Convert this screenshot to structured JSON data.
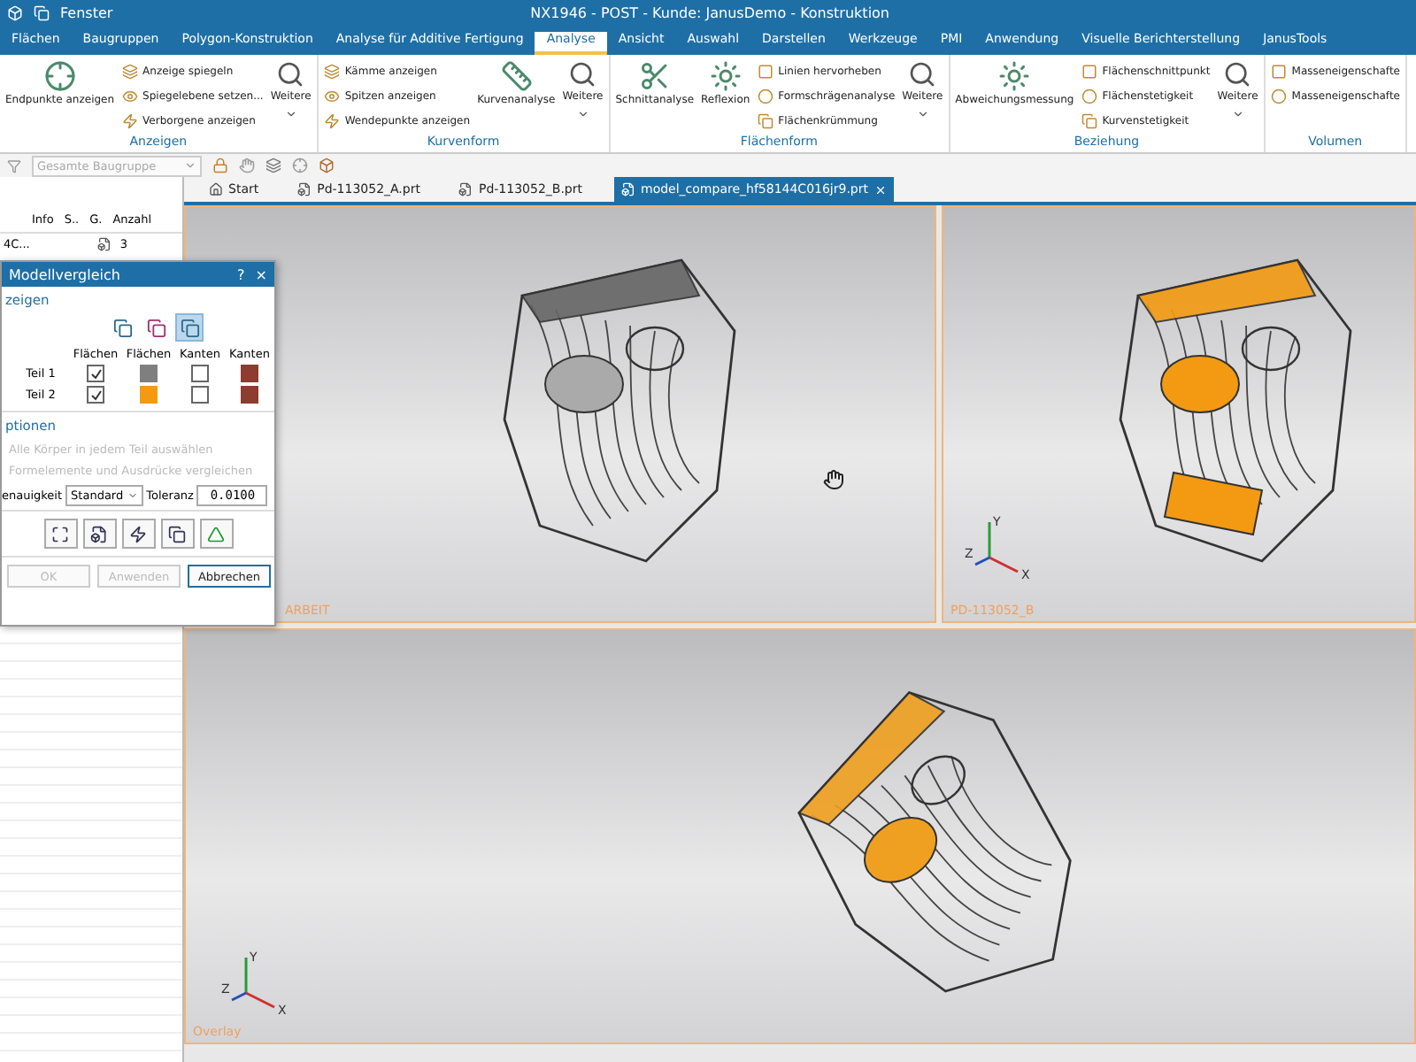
{
  "quick_access": {
    "window_menu": "Fenster"
  },
  "title": "NX1946 - POST - Kunde: JanusDemo - Konstruktion",
  "ribbon_tabs": [
    {
      "label": "Flächen",
      "selected": false
    },
    {
      "label": "Baugruppen",
      "selected": false
    },
    {
      "label": "Polygon-Konstruktion",
      "selected": false
    },
    {
      "label": "Analyse für Additive Fertigung",
      "selected": false
    },
    {
      "label": "Analyse",
      "selected": true
    },
    {
      "label": "Ansicht",
      "selected": false
    },
    {
      "label": "Auswahl",
      "selected": false
    },
    {
      "label": "Darstellen",
      "selected": false
    },
    {
      "label": "Werkzeuge",
      "selected": false
    },
    {
      "label": "PMI",
      "selected": false
    },
    {
      "label": "Anwendung",
      "selected": false
    },
    {
      "label": "Visuelle Berichterstellung",
      "selected": false
    },
    {
      "label": "JanusTools",
      "selected": false
    }
  ],
  "ribbon_groups": [
    {
      "name": "Anzeigen",
      "items": [
        {
          "kind": "large",
          "label": "Endpunkte anzeigen"
        },
        {
          "kind": "small",
          "label": "Anzeige spiegeln"
        },
        {
          "kind": "small",
          "label": "Spiegelebene setzen..."
        },
        {
          "kind": "small",
          "label": "Verborgene anzeigen"
        },
        {
          "kind": "more",
          "label": "Weitere"
        }
      ]
    },
    {
      "name": "Kurvenform",
      "items": [
        {
          "kind": "small",
          "label": "Kämme anzeigen"
        },
        {
          "kind": "small",
          "label": "Spitzen anzeigen"
        },
        {
          "kind": "small",
          "label": "Wendepunkte anzeigen"
        },
        {
          "kind": "large",
          "label": "Kurvenanalyse"
        },
        {
          "kind": "more",
          "label": "Weitere"
        }
      ]
    },
    {
      "name": "Flächenform",
      "items": [
        {
          "kind": "large",
          "label": "Schnittanalyse"
        },
        {
          "kind": "large",
          "label": "Reflexion"
        },
        {
          "kind": "small",
          "label": "Linien hervorheben"
        },
        {
          "kind": "small",
          "label": "Formschrägenanalyse"
        },
        {
          "kind": "small",
          "label": "Flächenkrümmung"
        },
        {
          "kind": "more",
          "label": "Weitere"
        }
      ]
    },
    {
      "name": "Beziehung",
      "items": [
        {
          "kind": "large",
          "label": "Abweichungsmessung"
        },
        {
          "kind": "small",
          "label": "Flächenschnittpunkt"
        },
        {
          "kind": "small",
          "label": "Flächenstetigkeit"
        },
        {
          "kind": "small",
          "label": "Kurvenstetigkeit"
        },
        {
          "kind": "more",
          "label": "Weitere"
        }
      ]
    },
    {
      "name": "Volumen",
      "items": [
        {
          "kind": "small",
          "label": "Masseneigenschafte"
        },
        {
          "kind": "small",
          "label": "Masseneigenschafte"
        }
      ]
    }
  ],
  "selection_filter": {
    "value": "Gesamte Baugruppe"
  },
  "doc_tabs": [
    {
      "label": "Start",
      "kind": "home",
      "selected": false
    },
    {
      "label": "Pd-113052_A.prt",
      "kind": "part",
      "selected": false
    },
    {
      "label": "Pd-113052_B.prt",
      "kind": "part",
      "selected": false
    },
    {
      "label": "model_compare_hf58144C016jr9.prt",
      "kind": "part",
      "selected": true
    }
  ],
  "navigator": {
    "columns": [
      "Info",
      "S..",
      "G.",
      "Anzahl"
    ],
    "rows": [
      {
        "name": "4C...",
        "count": "3"
      }
    ]
  },
  "viewports": [
    {
      "label": "ARBEIT",
      "kind": "work"
    },
    {
      "label": "PD-113052_B",
      "kind": "part_b",
      "triad": {
        "x": "X",
        "y": "Y",
        "z": "Z"
      }
    },
    {
      "label": "Overlay",
      "kind": "overlay",
      "triad": {
        "x": "X",
        "y": "Y",
        "z": "Z"
      }
    }
  ],
  "dialog": {
    "title": "Modellvergleich",
    "help": "?",
    "close": "×",
    "display_section": "zeigen",
    "display_modes": [
      {
        "selected": false
      },
      {
        "selected": false
      },
      {
        "selected": true
      }
    ],
    "columns": [
      "Flächen",
      "Flächen",
      "Kanten",
      "Kanten"
    ],
    "parts": [
      {
        "label": "Teil 1",
        "checked": true,
        "faces": {
          "color": "#7f7f7f"
        },
        "edges": {
          "checked": false,
          "color": "#8e3b30"
        }
      },
      {
        "label": "Teil 2",
        "checked": true,
        "faces": {
          "color": "#f39a12"
        },
        "edges": {
          "checked": false,
          "color": "#8e3b30"
        }
      }
    ],
    "options_section": "ptionen",
    "options": [
      {
        "label": "Alle Körper in jedem Teil auswählen",
        "disabled": true
      },
      {
        "label": "Formelemente und Ausdrücke vergleichen",
        "disabled": true
      }
    ],
    "accuracy_label": "enauigkeit",
    "accuracy": "Standard",
    "tolerance_label": "Toleranz",
    "tolerance": "0.0100",
    "buttons": [
      {
        "label": "OK",
        "disabled": true,
        "default": false
      },
      {
        "label": "Anwenden",
        "disabled": true,
        "default": false
      },
      {
        "label": "Abbrechen",
        "disabled": false,
        "default": true
      }
    ]
  }
}
